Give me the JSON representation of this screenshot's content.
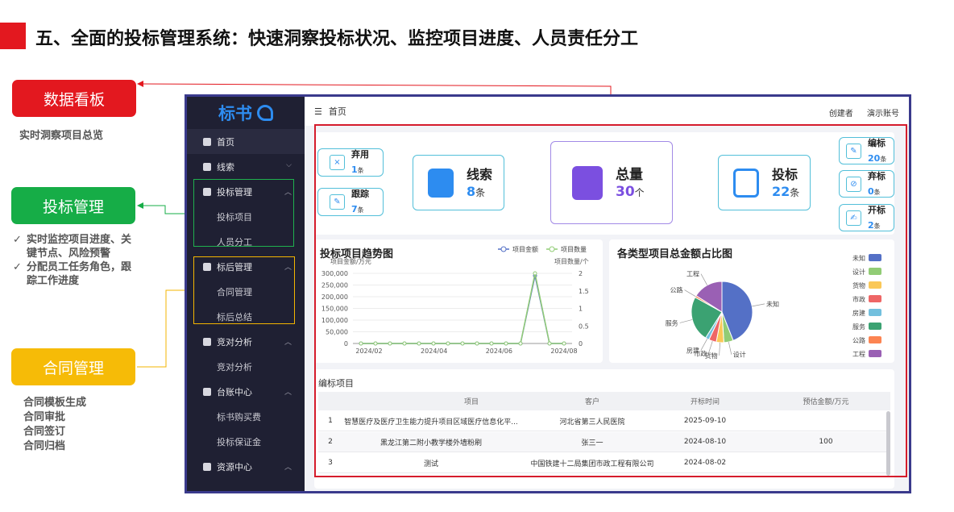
{
  "slide": {
    "title": "五、全面的投标管理系统：快速洞察投标状况、监控项目进度、人员责任分工",
    "callouts": {
      "dashboard": {
        "label": "数据看板",
        "note": "实时洞察项目总览"
      },
      "bid": {
        "label": "投标管理",
        "notes": [
          "实时监控项目进度、关键节点、风险预警",
          "分配员工任务角色，跟踪工作进度"
        ]
      },
      "contract": {
        "label": "合同管理",
        "notes": [
          "合同模板生成",
          "合同审批",
          "合同签订",
          "合同归档"
        ]
      }
    }
  },
  "app": {
    "logo": "标书",
    "topbar": {
      "breadcrumb": "首页",
      "creator": "创建者",
      "account": "演示账号"
    },
    "sidebar": [
      {
        "label": "首页"
      },
      {
        "label": "线索"
      },
      {
        "label": "投标管理",
        "children": [
          "投标项目",
          "人员分工"
        ]
      },
      {
        "label": "标后管理",
        "children": [
          "合同管理",
          "标后总结"
        ]
      },
      {
        "label": "竞对分析",
        "children": [
          "竞对分析"
        ]
      },
      {
        "label": "台账中心",
        "children": [
          "标书购买费",
          "投标保证金"
        ]
      },
      {
        "label": "资源中心"
      }
    ],
    "stats": {
      "abandoned": {
        "label": "弃用",
        "value": "1",
        "unit": "条"
      },
      "tracking": {
        "label": "跟踪",
        "value": "7",
        "unit": "条"
      },
      "leads": {
        "label": "线索",
        "value": "8",
        "unit": "条"
      },
      "total": {
        "label": "总量",
        "value": "30",
        "unit": "个"
      },
      "bidding": {
        "label": "投标",
        "value": "22",
        "unit": "条"
      },
      "editing": {
        "label": "编标",
        "value": "20",
        "unit": "条"
      },
      "abandon_bid": {
        "label": "弃标",
        "value": "0",
        "unit": "条"
      },
      "opening": {
        "label": "开标",
        "value": "2",
        "unit": "条"
      }
    },
    "trend_title": "投标项目趋势图",
    "pie_title": "各类型项目总金额占比图",
    "table": {
      "title": "编标项目",
      "headers": [
        "项目",
        "客户",
        "开标时间",
        "预估金额/万元"
      ],
      "rows": [
        {
          "index": "1",
          "project": "智慧医疗及医疗卫生能力提升项目区域医疗信息化平...",
          "client": "河北省第三人民医院",
          "date": "2025-09-10",
          "amount": ""
        },
        {
          "index": "2",
          "project": "黑龙江第二附小教学楼外墙粉刷",
          "client": "张三一",
          "date": "2024-08-10",
          "amount": "100"
        },
        {
          "index": "3",
          "project": "测试",
          "client": "中国铁建十二局集团市政工程有限公司",
          "date": "2024-08-02",
          "amount": ""
        }
      ]
    }
  },
  "colors": {
    "accent": "#2d8cf0",
    "red": "#e3181f",
    "green": "#16ad47",
    "yellow": "#f6bb07",
    "sidebar": "#1f2033"
  },
  "chart_data": [
    {
      "type": "line",
      "title": "投标项目趋势图",
      "x_ticks": [
        "2024/02",
        "2024/04",
        "2024/06",
        "2024/08"
      ],
      "ylabel_left": "项目金额/万元",
      "ylabel_right": "项目数量/个",
      "ylim_left": [
        0,
        300000
      ],
      "ylim_right": [
        0,
        2
      ],
      "y_ticks_left": [
        "0",
        "50,000",
        "100,000",
        "150,000",
        "200,000",
        "250,000",
        "300,000"
      ],
      "y_ticks_right": [
        "0",
        "0.5",
        "1",
        "1.5",
        "2"
      ],
      "series": [
        {
          "name": "项目金额",
          "axis": "left",
          "color": "#5470c6",
          "values": [
            0,
            0,
            0,
            0,
            0,
            0,
            0,
            0,
            0,
            0,
            0,
            0,
            290000,
            0,
            0
          ]
        },
        {
          "name": "项目数量",
          "axis": "right",
          "color": "#91cc75",
          "values": [
            0,
            0,
            0,
            0,
            0,
            0,
            0,
            0,
            0,
            0,
            0,
            0,
            2,
            0,
            0
          ]
        }
      ],
      "legend": "top-right"
    },
    {
      "type": "pie",
      "title": "各类型项目总金额占比图",
      "categories": [
        "未知",
        "设计",
        "货物",
        "市政",
        "房建",
        "服务",
        "公路",
        "工程"
      ],
      "values": [
        44,
        5,
        4,
        4,
        2,
        24,
        1,
        16
      ],
      "colors": [
        "#5470c6",
        "#91cc75",
        "#fac858",
        "#ee6666",
        "#73c0de",
        "#3ba272",
        "#fc8452",
        "#9a60b4"
      ],
      "legend": "right"
    }
  ]
}
